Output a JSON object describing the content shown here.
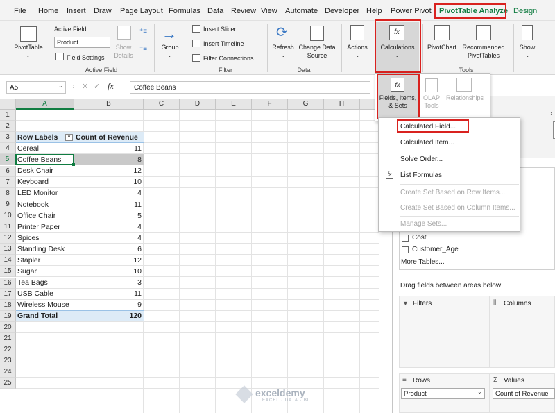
{
  "menu_tabs": [
    "File",
    "Home",
    "Insert",
    "Draw",
    "Page Layout",
    "Formulas",
    "Data",
    "Review",
    "View",
    "Automate",
    "Developer",
    "Help",
    "Power Pivot",
    "PivotTable Analyze",
    "Design"
  ],
  "ribbon": {
    "pivottable_label": "PivotTable",
    "active_field_label": "Active Field:",
    "active_field_value": "Product",
    "field_settings": "Field Settings",
    "show_details": "Show\nDetails",
    "group": "Group",
    "insert_slicer": "Insert Slicer",
    "insert_timeline": "Insert Timeline",
    "filter_connections": "Filter Connections",
    "refresh": "Refresh",
    "change_data_source": "Change Data\nSource",
    "actions": "Actions",
    "calculations": "Calculations",
    "pivotchart": "PivotChart",
    "recommended_pivottables": "Recommended\nPivotTables",
    "show": "Show",
    "group_labels": {
      "active_field": "Active Field",
      "filter": "Filter",
      "data": "Data",
      "tools": "Tools"
    }
  },
  "calc_sub": {
    "fields_items_sets": "Fields, Items,\n& Sets",
    "olap_tools": "OLAP\nTools",
    "relationships": "Relationships"
  },
  "calc_menu": [
    {
      "label": "Calculated Field...",
      "disabled": false
    },
    {
      "label": "Calculated Item...",
      "disabled": false
    },
    {
      "label": "Solve Order...",
      "disabled": false
    },
    {
      "label": "List Formulas",
      "disabled": false
    },
    {
      "label": "Create Set Based on Row Items...",
      "disabled": true
    },
    {
      "label": "Create Set Based on Column Items...",
      "disabled": true
    },
    {
      "label": "Manage Sets...",
      "disabled": true
    }
  ],
  "formula_bar": {
    "name_box": "A5",
    "fx": "fx",
    "content": "Coffee Beans"
  },
  "columns": [
    "A",
    "B",
    "C",
    "D",
    "E",
    "F",
    "G",
    "H"
  ],
  "rows": [
    "1",
    "2",
    "3",
    "4",
    "5",
    "6",
    "7",
    "8",
    "9",
    "10",
    "11",
    "12",
    "13",
    "14",
    "15",
    "16",
    "17",
    "18",
    "19",
    "20",
    "21",
    "22",
    "23",
    "24",
    "25"
  ],
  "pivot": {
    "header_labels": "Row Labels",
    "header_values": "Count of Revenue",
    "items": [
      {
        "label": "Cereal",
        "value": "11"
      },
      {
        "label": "Coffee Beans",
        "value": "8"
      },
      {
        "label": "Desk Chair",
        "value": "12"
      },
      {
        "label": "Keyboard",
        "value": "10"
      },
      {
        "label": "LED Monitor",
        "value": "4"
      },
      {
        "label": "Notebook",
        "value": "11"
      },
      {
        "label": "Office Chair",
        "value": "5"
      },
      {
        "label": "Printer Paper",
        "value": "4"
      },
      {
        "label": "Spices",
        "value": "4"
      },
      {
        "label": "Standing Desk",
        "value": "6"
      },
      {
        "label": "Stapler",
        "value": "12"
      },
      {
        "label": "Sugar",
        "value": "10"
      },
      {
        "label": "Tea Bags",
        "value": "3"
      },
      {
        "label": "USB Cable",
        "value": "11"
      },
      {
        "label": "Wireless Mouse",
        "value": "9"
      }
    ],
    "grand_total_label": "Grand Total",
    "grand_total_value": "120"
  },
  "field_panel": {
    "fields": [
      "Cost",
      "Customer_Age"
    ],
    "more_tables": "More Tables...",
    "drag_hint": "Drag fields between areas below:",
    "filters": "Filters",
    "columns": "Columns",
    "rows": "Rows",
    "values": "Values",
    "rows_item": "Product",
    "values_item": "Count of Revenue"
  },
  "watermark": {
    "name": "exceldemy",
    "tagline": "EXCEL · DATA · BI"
  }
}
